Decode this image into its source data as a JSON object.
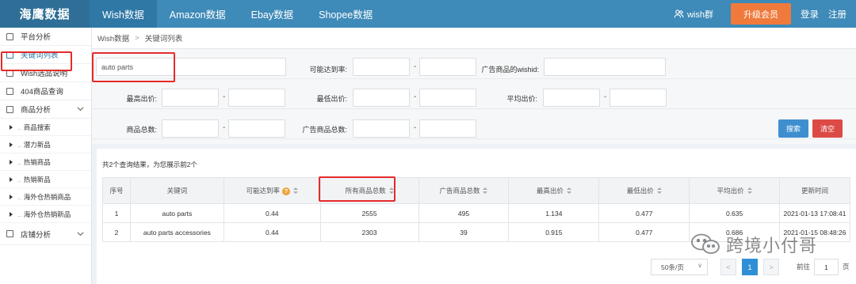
{
  "app": {
    "logo": "海鹰数据"
  },
  "nav": {
    "items": [
      "Wish数据",
      "Amazon数据",
      "Ebay数据",
      "Shopee数据"
    ],
    "active": 0
  },
  "header": {
    "user": "wish群",
    "upgrade": "升级会员",
    "login": "登录",
    "register": "注册"
  },
  "sidebar": {
    "items": [
      {
        "label": "平台分析"
      },
      {
        "label": "关键词列表",
        "active": true
      },
      {
        "label": "Wish选品说明"
      },
      {
        "label": "404商品查询"
      },
      {
        "label": "商品分析",
        "expandable": true
      }
    ],
    "sub_items": [
      "商品搜索",
      "潜力新品",
      "热销商品",
      "热销新品",
      "海外仓热销商品",
      "海外仓热销新品"
    ],
    "bottom": {
      "label": "店铺分析",
      "expandable": true
    }
  },
  "breadcrumb": [
    "Wish数据",
    "关键词列表"
  ],
  "filters": {
    "keyword": "auto parts",
    "reach_rate_label": "可能达到率:",
    "ad_wishid_label": "广告商品的wishid:",
    "max_price_label": "最高出价:",
    "min_price_label": "最低出价:",
    "avg_price_label": "平均出价:",
    "total_products_label": "商品总数:",
    "ad_total_label": "广告商品总数:",
    "dash": "-",
    "search_btn": "搜索",
    "clear_btn": "清空"
  },
  "result": {
    "summary": "共2个查询结果，为您展示前2个",
    "columns": [
      "序号",
      "关键词",
      "可能达到率",
      "所有商品总数",
      "广告商品总数",
      "最高出价",
      "最低出价",
      "平均出价",
      "更新时间"
    ],
    "help_glyph": "?",
    "rows": [
      [
        "1",
        "auto parts",
        "0.44",
        "2555",
        "495",
        "1.134",
        "0.477",
        "0.635",
        "2021-01-13 17:08:41"
      ],
      [
        "2",
        "auto parts accessories",
        "0.44",
        "2303",
        "39",
        "0.915",
        "0.477",
        "0.686",
        "2021-01-15 08:48:26"
      ]
    ]
  },
  "pagination": {
    "page_size": "50条/页",
    "current": "1",
    "prev": "<",
    "next": ">",
    "goto_prefix": "前往",
    "goto_value": "1",
    "goto_suffix": "页"
  },
  "watermark": "跨境小付哥",
  "colors": {
    "topbar": "#3e8ab8",
    "accent": "#2f78a6",
    "upgrade": "#f07a3c",
    "search": "#3f8fd0",
    "clear": "#dc4a46",
    "highlight": "#e62a2a"
  }
}
